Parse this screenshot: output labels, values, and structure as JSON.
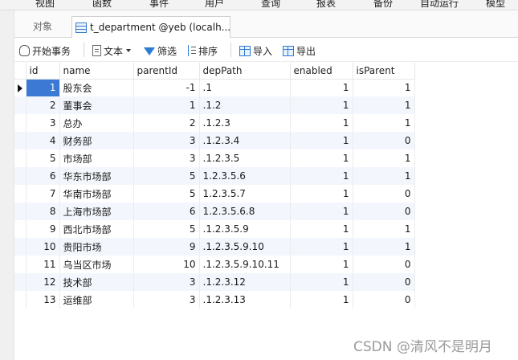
{
  "menu": [
    "视图",
    "函数",
    "事件",
    "用户",
    "查询",
    "报表",
    "备份",
    "自动运行",
    "模型"
  ],
  "tabs": {
    "objects_label": "对象",
    "active_label": "t_department @yeb (localh..."
  },
  "toolbar": {
    "begin_transaction": "开始事务",
    "text": "文本",
    "filter": "筛选",
    "sort": "排序",
    "import": "导入",
    "export": "导出"
  },
  "table": {
    "columns": [
      "id",
      "name",
      "parentId",
      "depPath",
      "enabled",
      "isParent"
    ],
    "rows": [
      {
        "id": "1",
        "name": "股东会",
        "parentId": "-1",
        "depPath": ".1",
        "enabled": "1",
        "isParent": "1"
      },
      {
        "id": "2",
        "name": "董事会",
        "parentId": "1",
        "depPath": ".1.2",
        "enabled": "1",
        "isParent": "1"
      },
      {
        "id": "3",
        "name": "总办",
        "parentId": "2",
        "depPath": ".1.2.3",
        "enabled": "1",
        "isParent": "1"
      },
      {
        "id": "4",
        "name": "财务部",
        "parentId": "3",
        "depPath": ".1.2.3.4",
        "enabled": "1",
        "isParent": "0"
      },
      {
        "id": "5",
        "name": "市场部",
        "parentId": "3",
        "depPath": ".1.2.3.5",
        "enabled": "1",
        "isParent": "1"
      },
      {
        "id": "6",
        "name": "华东市场部",
        "parentId": "5",
        "depPath": "1.2.3.5.6",
        "enabled": "1",
        "isParent": "1"
      },
      {
        "id": "7",
        "name": "华南市场部",
        "parentId": "5",
        "depPath": "1.2.3.5.7",
        "enabled": "1",
        "isParent": "0"
      },
      {
        "id": "8",
        "name": "上海市场部",
        "parentId": "6",
        "depPath": "1.2.3.5.6.8",
        "enabled": "1",
        "isParent": "0"
      },
      {
        "id": "9",
        "name": "西北市场部",
        "parentId": "5",
        "depPath": ".1.2.3.5.9",
        "enabled": "1",
        "isParent": "1"
      },
      {
        "id": "10",
        "name": "贵阳市场",
        "parentId": "9",
        "depPath": ".1.2.3.5.9.10",
        "enabled": "1",
        "isParent": "1"
      },
      {
        "id": "11",
        "name": "乌当区市场",
        "parentId": "10",
        "depPath": ".1.2.3.5.9.10.11",
        "enabled": "1",
        "isParent": "0"
      },
      {
        "id": "12",
        "name": "技术部",
        "parentId": "3",
        "depPath": ".1.2.3.12",
        "enabled": "1",
        "isParent": "0"
      },
      {
        "id": "13",
        "name": "运维部",
        "parentId": "3",
        "depPath": ".1.2.3.13",
        "enabled": "1",
        "isParent": "0"
      }
    ]
  },
  "watermark": "CSDN @清风不是明月",
  "colors": {
    "selection": "#3b79d4",
    "alt_row": "#f3f7fd",
    "icon_blue": "#2e7bd4"
  }
}
